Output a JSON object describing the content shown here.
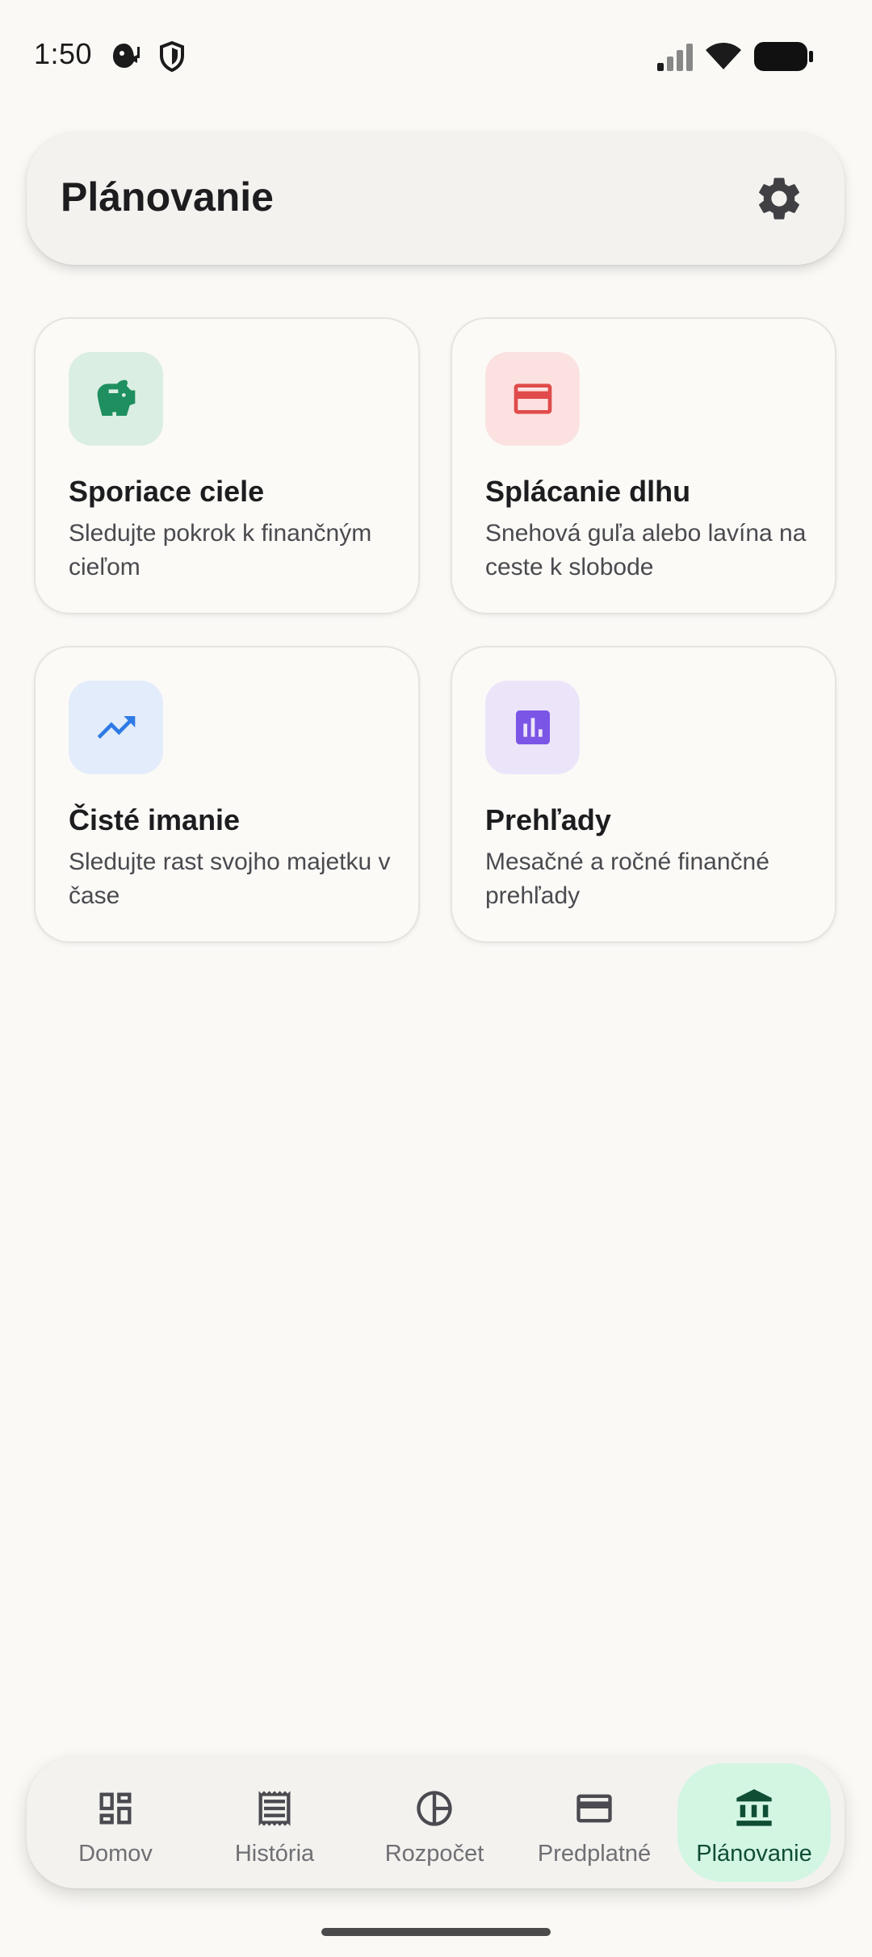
{
  "status_bar": {
    "time": "1:50"
  },
  "header": {
    "title": "Plánovanie"
  },
  "cards": [
    {
      "title": "Sporiace ciele",
      "description": "Sledujte pokrok k finančným cieľom",
      "icon": "piggy-bank-icon",
      "color": "#1f8f5f",
      "bg": "#dbeee3"
    },
    {
      "title": "Splácanie dlhu",
      "description": "Snehová guľa alebo lavína na ceste k slobode",
      "icon": "credit-card-icon",
      "color": "#e14b4b",
      "bg": "#fbe2e1"
    },
    {
      "title": "Čisté imanie",
      "description": "Sledujte rast svojho majetku v čase",
      "icon": "trending-up-icon",
      "color": "#2f7be5",
      "bg": "#e3ecfa"
    },
    {
      "title": "Prehľady",
      "description": "Mesačné a ročné finančné prehľady",
      "icon": "bar-chart-icon",
      "color": "#7b55e6",
      "bg": "#ece5fa"
    }
  ],
  "nav": {
    "items": [
      {
        "label": "Domov",
        "icon": "dashboard-icon"
      },
      {
        "label": "História",
        "icon": "receipt-icon"
      },
      {
        "label": "Rozpočet",
        "icon": "pie-chart-icon"
      },
      {
        "label": "Predplatné",
        "icon": "card-icon"
      },
      {
        "label": "Plánovanie",
        "icon": "bank-icon"
      }
    ],
    "active": "Plánovanie",
    "active_color": "#d3f6e3"
  }
}
